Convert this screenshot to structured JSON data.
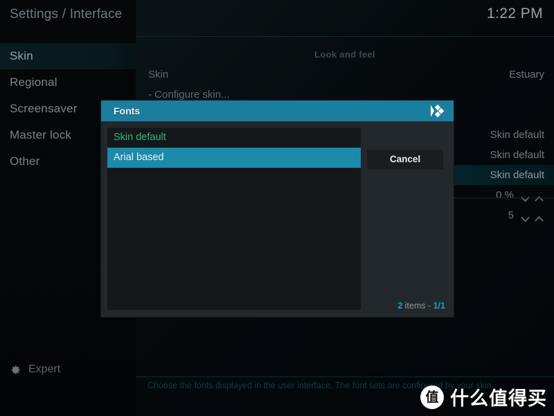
{
  "topbar": {
    "breadcrumb": "Settings / Interface",
    "clock": "1:22 PM"
  },
  "sidebar": {
    "items": [
      {
        "label": "Skin",
        "active": true
      },
      {
        "label": "Regional",
        "active": false
      },
      {
        "label": "Screensaver",
        "active": false
      },
      {
        "label": "Master lock",
        "active": false
      },
      {
        "label": "Other",
        "active": false
      }
    ],
    "expert": {
      "label": "Expert",
      "icon": "gear-icon"
    }
  },
  "panel": {
    "title": "Look and feel",
    "rows": [
      {
        "label": "Skin",
        "value": "Estuary",
        "type": "value",
        "selected": false
      },
      {
        "label": "- Configure skin...",
        "value": "",
        "type": "action",
        "selected": false
      },
      {
        "label": "",
        "value": "",
        "type": "value",
        "selected": false
      },
      {
        "label": "",
        "value": "Skin default",
        "type": "value",
        "selected": false
      },
      {
        "label": "",
        "value": "Skin default",
        "type": "value",
        "selected": false
      },
      {
        "label": "",
        "value": "Skin default",
        "type": "value",
        "selected": true
      },
      {
        "label": "",
        "value": "0 %",
        "type": "spinner",
        "selected": false
      },
      {
        "label": "",
        "value": "5",
        "type": "spinner",
        "selected": false
      }
    ]
  },
  "help": {
    "text": "Choose the fonts displayed in the user interface. The font sets are configured by your skin."
  },
  "dialog": {
    "title": "Fonts",
    "logo_icon": "kodi-logo-icon",
    "options": [
      {
        "label": "Skin default",
        "state": "current"
      },
      {
        "label": "Arial based",
        "state": "focused"
      }
    ],
    "cancel_label": "Cancel",
    "count_prefix": "2",
    "count_middle": " items - ",
    "count_page": "1/1"
  },
  "watermark": {
    "badge": "值",
    "text": "什么值得买"
  },
  "colors": {
    "accent_teal": "#1b7e9f",
    "highlight_teal": "#1b8aab",
    "current_green": "#2fb87e",
    "count_blue": "#1b9ec4",
    "dialog_bg": "#22282b",
    "list_bg": "#14181a"
  }
}
